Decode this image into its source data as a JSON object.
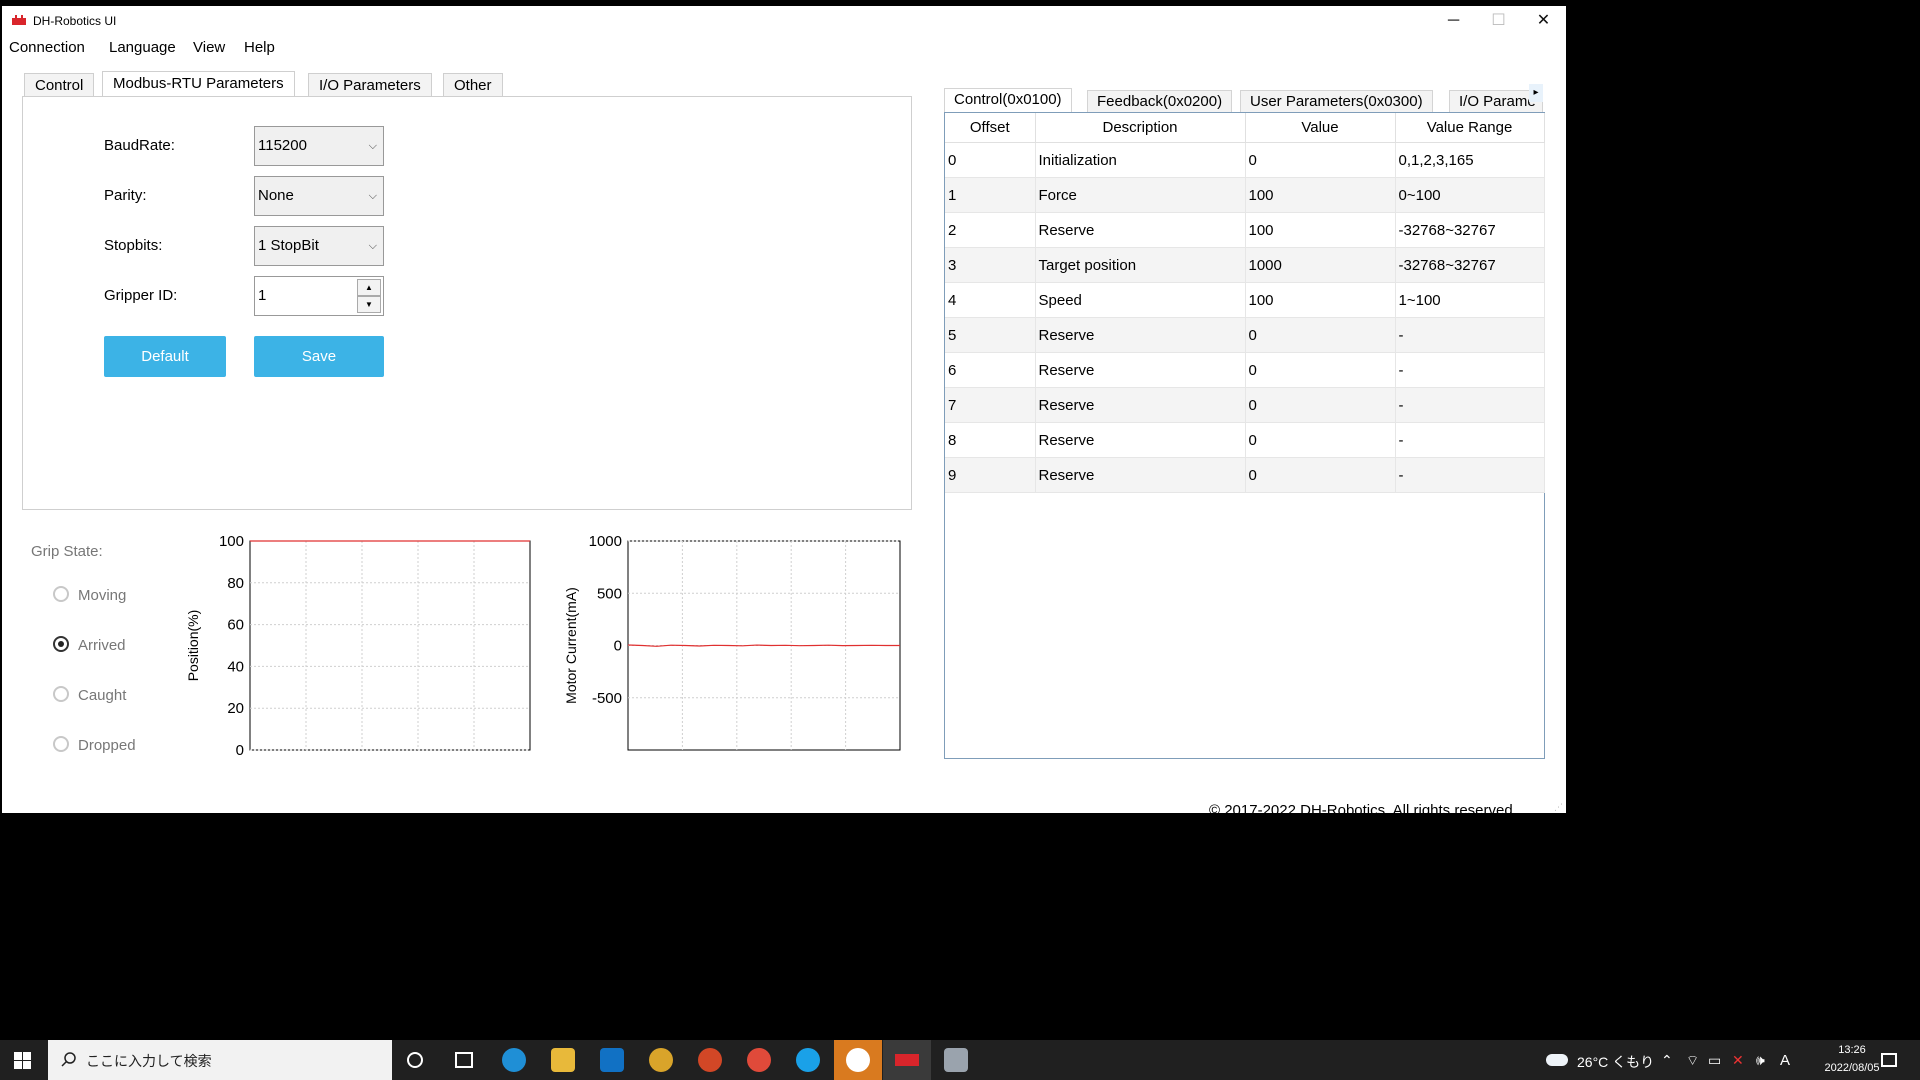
{
  "window": {
    "title": "DH-Robotics UI",
    "minimize_glyph": "─",
    "maximize_glyph": "☐",
    "close_glyph": "✕"
  },
  "menu": [
    "Connection",
    "Language",
    "View",
    "Help"
  ],
  "left_tabs": [
    "Control",
    "Modbus-RTU Parameters",
    "I/O Parameters",
    "Other"
  ],
  "left_active_tab": "Modbus-RTU Parameters",
  "form": {
    "baudrate_label": "BaudRate:",
    "baudrate_value": "115200",
    "parity_label": "Parity:",
    "parity_value": "None",
    "stopbits_label": "Stopbits:",
    "stopbits_value": "1 StopBit",
    "gripper_id_label": "Gripper ID:",
    "gripper_id_value": "1",
    "default_button": "Default",
    "save_button": "Save"
  },
  "grip_state": {
    "label": "Grip State:",
    "options": [
      "Moving",
      "Arrived",
      "Caught",
      "Dropped"
    ],
    "selected": "Arrived"
  },
  "chart_data": [
    {
      "type": "line",
      "title": "",
      "xlabel": "",
      "ylabel": "Position(%)",
      "ylim": [
        0,
        100
      ],
      "yticks": [
        0,
        20,
        40,
        60,
        80,
        100
      ],
      "grid": true,
      "series": [
        {
          "values": [
            100,
            100,
            100,
            100,
            100,
            100,
            100,
            100,
            100,
            100
          ],
          "color": "#e03030"
        }
      ]
    },
    {
      "type": "line",
      "title": "",
      "xlabel": "",
      "ylabel": "Motor Current(mA)",
      "ylim": [
        -1000,
        1000
      ],
      "yticks": [
        -500,
        0,
        500,
        1000
      ],
      "grid": true,
      "series": [
        {
          "values": [
            5,
            0,
            -8,
            3,
            0,
            -5,
            2,
            0,
            -3,
            4,
            0,
            2,
            -2,
            0,
            3,
            -1,
            0,
            2,
            0,
            0
          ],
          "color": "#e03030"
        }
      ]
    }
  ],
  "right_tabs": [
    "Control(0x0100)",
    "Feedback(0x0200)",
    "User Parameters(0x0300)",
    "I/O Parame"
  ],
  "right_active_tab": "Control(0x0100)",
  "table": {
    "columns": [
      "Offset",
      "Description",
      "Value",
      "Value Range"
    ],
    "rows": [
      [
        "0",
        "Initialization",
        "0",
        "0,1,2,3,165"
      ],
      [
        "1",
        "Force",
        "100",
        "0~100"
      ],
      [
        "2",
        "Reserve",
        "100",
        "-32768~32767"
      ],
      [
        "3",
        "Target position",
        "1000",
        "-32768~32767"
      ],
      [
        "4",
        "Speed",
        "100",
        "1~100"
      ],
      [
        "5",
        "Reserve",
        "0",
        "-"
      ],
      [
        "6",
        "Reserve",
        "0",
        "-"
      ],
      [
        "7",
        "Reserve",
        "0",
        "-"
      ],
      [
        "8",
        "Reserve",
        "0",
        "-"
      ],
      [
        "9",
        "Reserve",
        "0",
        "-"
      ]
    ]
  },
  "footer": "© 2017-2022 DH-Robotics. All rights reserved",
  "taskbar": {
    "search_placeholder": "ここに入力して検索",
    "weather": "26°C くもり",
    "time": "13:26",
    "date": "2022/08/05",
    "ime": "A"
  }
}
